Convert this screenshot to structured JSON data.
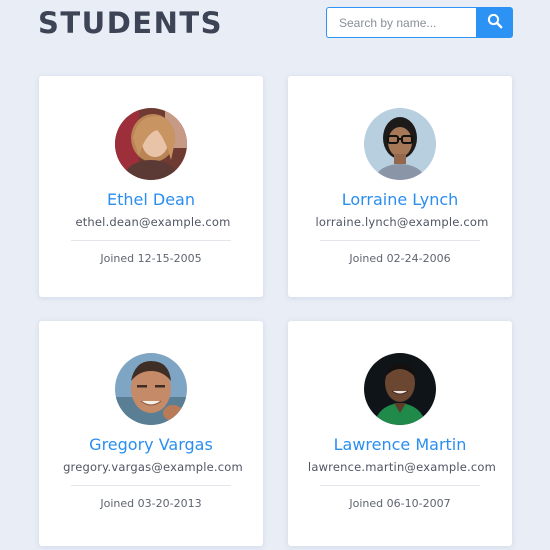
{
  "header": {
    "title": "STUDENTS",
    "search_placeholder": "Search by name...",
    "search_icon": "magnifier"
  },
  "colors": {
    "accent": "#2c93f5",
    "background": "#e8edf6",
    "title": "#3d4456"
  },
  "students": [
    {
      "name": "Ethel Dean",
      "email": "ethel.dean@example.com",
      "joined": "Joined 12-15-2005"
    },
    {
      "name": "Lorraine Lynch",
      "email": "lorraine.lynch@example.com",
      "joined": "Joined 02-24-2006"
    },
    {
      "name": "Gregory Vargas",
      "email": "gregory.vargas@example.com",
      "joined": "Joined 03-20-2013"
    },
    {
      "name": "Lawrence Martin",
      "email": "lawrence.martin@example.com",
      "joined": "Joined 06-10-2007"
    }
  ]
}
